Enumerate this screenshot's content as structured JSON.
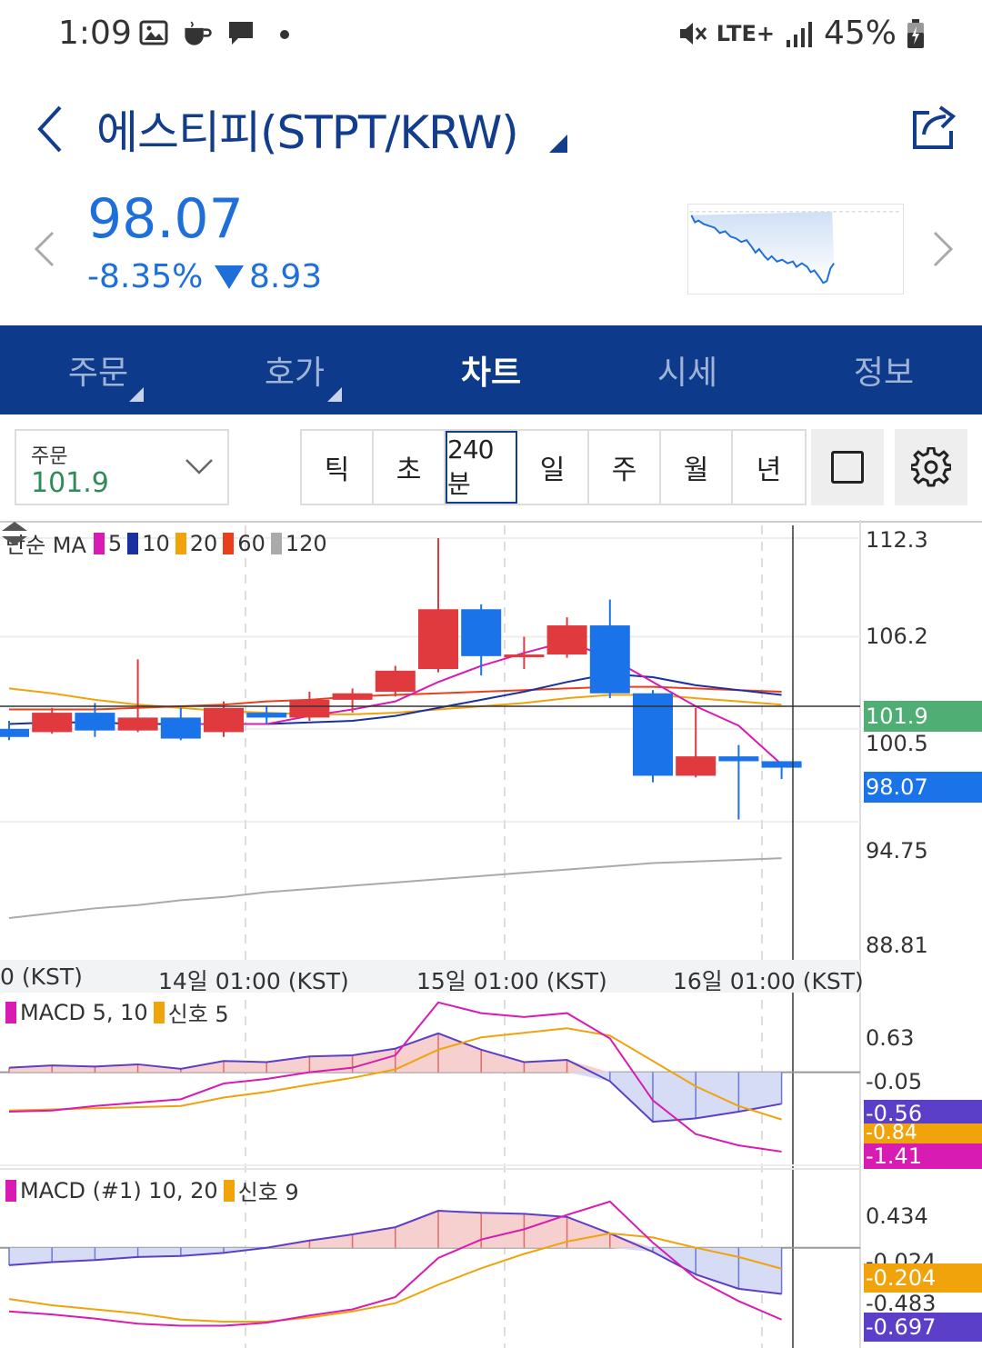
{
  "status_bar": {
    "time": "1:09",
    "network": "LTE+",
    "battery": "45%",
    "icons": [
      "gallery-icon",
      "coffee-icon",
      "chat-icon",
      "dot-icon",
      "mute-icon",
      "signal-icon",
      "battery-charging-icon"
    ]
  },
  "header": {
    "title": "에스티피(STPT/KRW)"
  },
  "quote": {
    "price": "98.07",
    "change_pct": "-8.35%",
    "change_abs": "8.93",
    "direction": "down"
  },
  "tabs": [
    {
      "label": "주문",
      "active": false,
      "has_menu": true
    },
    {
      "label": "호가",
      "active": false,
      "has_menu": true
    },
    {
      "label": "차트",
      "active": true,
      "has_menu": false
    },
    {
      "label": "시세",
      "active": false,
      "has_menu": false
    },
    {
      "label": "정보",
      "active": false,
      "has_menu": false
    }
  ],
  "order_select": {
    "label": "주문",
    "value": "101.9"
  },
  "intervals": [
    {
      "label": "틱",
      "active": false
    },
    {
      "label": "초",
      "active": false
    },
    {
      "label": "240분",
      "active": true
    },
    {
      "label": "일",
      "active": false
    },
    {
      "label": "주",
      "active": false
    },
    {
      "label": "월",
      "active": false
    },
    {
      "label": "년",
      "active": false
    }
  ],
  "colors": {
    "navy": "#0d3a8a",
    "up": "#e0393e",
    "down": "#1a73e8",
    "ma5": "#d81bb3",
    "ma10": "#1a2fa0",
    "ma20": "#f0a30a",
    "ma60": "#e8401c",
    "ma120": "#aaaaaa",
    "green_tag": "#4fae73"
  },
  "chart_data": [
    {
      "type": "candlestick",
      "legend_prefix": "단순 MA",
      "legend": [
        {
          "label": "5",
          "color": "#d81bb3"
        },
        {
          "label": "10",
          "color": "#1a2fa0"
        },
        {
          "label": "20",
          "color": "#f0a30a"
        },
        {
          "label": "60",
          "color": "#e8401c"
        },
        {
          "label": "120",
          "color": "#aaaaaa"
        }
      ],
      "y_ticks": [
        "112.3",
        "106.2",
        "100.5",
        "94.75",
        "88.81"
      ],
      "ylim": [
        87.0,
        112.3
      ],
      "x_ticks": [
        "0 (KST)",
        "14일 01:00 (KST)",
        "15일 01:00 (KST)",
        "16일 01:00 (KST)"
      ],
      "price_tags": [
        {
          "label": "101.9",
          "value": 101.9,
          "color": "#4fae73"
        },
        {
          "label": "98.07",
          "value": 98.07,
          "color": "#1a73e8"
        }
      ],
      "candles": [
        {
          "o": 100.5,
          "c": 100.0,
          "h": 101.0,
          "l": 99.8
        },
        {
          "o": 100.3,
          "c": 101.5,
          "h": 101.8,
          "l": 100.2
        },
        {
          "o": 101.5,
          "c": 100.4,
          "h": 102.1,
          "l": 100.0
        },
        {
          "o": 100.4,
          "c": 101.2,
          "h": 104.8,
          "l": 100.3
        },
        {
          "o": 101.2,
          "c": 99.9,
          "h": 101.8,
          "l": 99.8
        },
        {
          "o": 100.3,
          "c": 101.8,
          "h": 102.2,
          "l": 100.0
        },
        {
          "o": 101.5,
          "c": 101.2,
          "h": 101.9,
          "l": 100.8
        },
        {
          "o": 101.2,
          "c": 102.3,
          "h": 102.8,
          "l": 101.0
        },
        {
          "o": 102.3,
          "c": 102.7,
          "h": 103.0,
          "l": 101.5
        },
        {
          "o": 102.8,
          "c": 104.1,
          "h": 104.4,
          "l": 102.5
        },
        {
          "o": 104.2,
          "c": 107.9,
          "h": 112.3,
          "l": 104.0
        },
        {
          "o": 107.9,
          "c": 105.0,
          "h": 108.2,
          "l": 103.8
        },
        {
          "o": 105.0,
          "c": 105.1,
          "h": 106.2,
          "l": 104.2
        },
        {
          "o": 105.1,
          "c": 106.9,
          "h": 107.4,
          "l": 104.9
        },
        {
          "o": 106.9,
          "c": 102.7,
          "h": 108.5,
          "l": 102.4
        },
        {
          "o": 102.7,
          "c": 97.6,
          "h": 102.9,
          "l": 97.2
        },
        {
          "o": 97.6,
          "c": 98.8,
          "h": 101.8,
          "l": 97.5
        },
        {
          "o": 98.8,
          "c": 98.5,
          "h": 99.5,
          "l": 94.9
        },
        {
          "o": 98.5,
          "c": 98.1,
          "h": 98.5,
          "l": 97.4
        }
      ],
      "ma": {
        "ma5": [
          null,
          null,
          null,
          null,
          100.8,
          100.8,
          100.8,
          101.3,
          101.7,
          102.2,
          103.4,
          104.4,
          105.2,
          105.9,
          104.9,
          103.4,
          101.9,
          100.7,
          98.3
        ],
        "ma10": [
          100.8,
          100.9,
          100.9,
          100.8,
          100.8,
          100.8,
          100.8,
          100.9,
          101.0,
          101.3,
          101.8,
          102.3,
          102.8,
          103.4,
          103.9,
          103.7,
          103.2,
          102.9,
          102.6
        ],
        "ma20": [
          103.0,
          102.7,
          102.3,
          102.0,
          101.8,
          101.6,
          101.5,
          101.4,
          101.4,
          101.5,
          101.7,
          101.9,
          102.1,
          102.4,
          102.6,
          102.6,
          102.4,
          102.2,
          102.0
        ],
        "ma60": [
          101.7,
          101.7,
          101.7,
          101.8,
          101.9,
          102.0,
          102.2,
          102.3,
          102.5,
          102.6,
          102.7,
          102.8,
          102.9,
          103.0,
          103.1,
          103.1,
          103.0,
          102.9,
          102.8
        ],
        "ma120": [
          88.8,
          89.1,
          89.4,
          89.6,
          89.9,
          90.1,
          90.4,
          90.6,
          90.8,
          91.0,
          91.2,
          91.4,
          91.6,
          91.8,
          92.0,
          92.2,
          92.3,
          92.4,
          92.5
        ]
      }
    },
    {
      "type": "macd",
      "legend_label": "MACD 5, 10",
      "signal_label": "신호 5",
      "y_ticks": [
        "0.63",
        "-0.05"
      ],
      "ylim": [
        -1.75,
        1.35
      ],
      "tags": [
        {
          "label": "-0.56",
          "color": "#5b3fc9"
        },
        {
          "label": "-0.84",
          "color": "#f0a30a"
        },
        {
          "label": "-1.41",
          "color": "#d81bb3"
        }
      ],
      "macd": [
        -0.7,
        -0.68,
        -0.6,
        -0.54,
        -0.48,
        -0.2,
        -0.12,
        0.0,
        0.08,
        0.3,
        1.24,
        1.05,
        0.98,
        1.05,
        0.6,
        -0.5,
        -1.1,
        -1.3,
        -1.41
      ],
      "signal": [
        -0.68,
        -0.66,
        -0.64,
        -0.62,
        -0.6,
        -0.45,
        -0.35,
        -0.22,
        -0.1,
        0.05,
        0.4,
        0.62,
        0.7,
        0.78,
        0.65,
        0.2,
        -0.25,
        -0.6,
        -0.84
      ],
      "hist": [
        0.08,
        0.12,
        0.1,
        0.14,
        0.06,
        0.2,
        0.18,
        0.28,
        0.3,
        0.42,
        0.69,
        0.4,
        0.18,
        0.22,
        -0.16,
        -0.88,
        -0.82,
        -0.7,
        -0.56
      ]
    },
    {
      "type": "macd",
      "legend_label": "MACD (#1) 10, 20",
      "signal_label": "신호 9",
      "y_ticks": [
        "0.434",
        "-0.024",
        "-0.483"
      ],
      "ylim": [
        -0.95,
        0.75
      ],
      "tags": [
        {
          "label": "-0.204",
          "color": "#f0a30a"
        },
        {
          "label": "-0.697",
          "color": "#5b3fc9"
        }
      ],
      "macd": [
        -0.62,
        -0.65,
        -0.69,
        -0.74,
        -0.76,
        -0.76,
        -0.73,
        -0.66,
        -0.6,
        -0.48,
        -0.1,
        0.08,
        0.18,
        0.32,
        0.45,
        0.05,
        -0.3,
        -0.52,
        -0.7
      ],
      "signal": [
        -0.5,
        -0.56,
        -0.6,
        -0.64,
        -0.7,
        -0.72,
        -0.72,
        -0.68,
        -0.62,
        -0.54,
        -0.36,
        -0.2,
        -0.06,
        0.06,
        0.14,
        0.1,
        0.0,
        -0.09,
        -0.204
      ],
      "hist": [
        -0.17,
        -0.14,
        -0.12,
        -0.09,
        -0.08,
        -0.05,
        0.0,
        0.07,
        0.13,
        0.2,
        0.36,
        0.34,
        0.33,
        0.3,
        0.14,
        -0.04,
        -0.26,
        -0.4,
        -0.45
      ]
    }
  ]
}
